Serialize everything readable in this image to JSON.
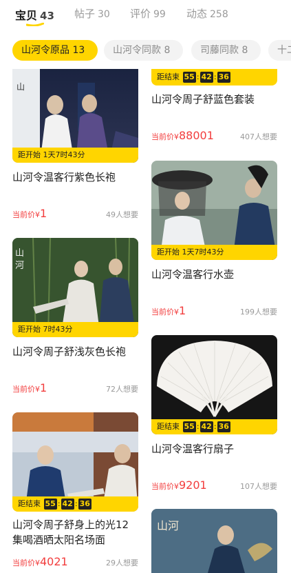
{
  "tabs": [
    {
      "label": "宝贝",
      "count": "43",
      "active": true
    },
    {
      "label": "帖子",
      "count": "30"
    },
    {
      "label": "评价",
      "count": "99"
    },
    {
      "label": "动态",
      "count": "258"
    }
  ],
  "chips": [
    {
      "label": "山河令原品 13",
      "active": true
    },
    {
      "label": "山河令同款 8"
    },
    {
      "label": "司藤同款 8"
    },
    {
      "label": "十二"
    }
  ],
  "colors": {
    "accent": "#ffd500",
    "price": "#f23d3d",
    "muted": "#999999"
  },
  "badge_text": {
    "ends": "距结束",
    "starts": "距开始"
  },
  "countdown": [
    "55",
    "42",
    "36"
  ],
  "price_label": "当前价¥",
  "left_column": [
    {
      "badge": "距开始 1天7时43分",
      "title": "山河令温客行紫色长袍",
      "price": "1",
      "wants": "49人想要"
    },
    {
      "badge": "距开始 7时43分",
      "title": "山河令周子舒浅灰色长袍",
      "price": "1",
      "wants": "72人想要"
    },
    {
      "badge": "距结束",
      "title_line1": "山河令周子舒身上的光12",
      "title_line2": "集喝酒晒太阳名场面",
      "price": "4021",
      "wants": "29人想要"
    }
  ],
  "right_column": [
    {
      "badge": "距结束",
      "title": "山河令周子舒蓝色套装",
      "price": "88001",
      "wants": "407人想要"
    },
    {
      "badge": "距开始 1天7时43分",
      "title": "山河令温客行水壶",
      "price": "1",
      "wants": "199人想要"
    },
    {
      "badge": "距结束",
      "title": "山河令温客行扇子",
      "price": "9201",
      "wants": "107人想要"
    }
  ],
  "images": {
    "left_1": "drama-still-night-scene",
    "left_2": "drama-still-bamboo-forest",
    "left_3": "drama-still-daylight-scene",
    "right_2": "drama-still-bamboo-hat",
    "right_3": "white-folding-fan",
    "right_4": "drama-poster"
  }
}
